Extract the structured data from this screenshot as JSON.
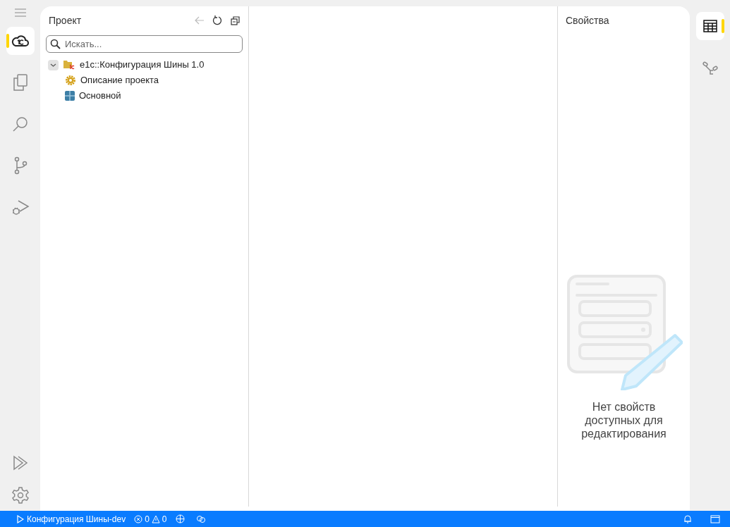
{
  "activity_bar": {
    "items": [
      {
        "kind": "cloud",
        "selected": true
      },
      {
        "kind": "files",
        "selected": false
      },
      {
        "kind": "search",
        "selected": false
      },
      {
        "kind": "branch",
        "selected": false
      },
      {
        "kind": "debug",
        "selected": false
      }
    ],
    "bottom_items": [
      {
        "kind": "run"
      },
      {
        "kind": "settings"
      }
    ]
  },
  "project_panel": {
    "title": "Проект",
    "search": {
      "placeholder": "Искать..."
    },
    "tree": [
      {
        "label": "e1c::Конфигурация Шины 1.0",
        "kind": "project",
        "expanded": true,
        "children": [
          {
            "label": "Описание проекта",
            "kind": "description"
          },
          {
            "label": "Основной",
            "kind": "subsystem"
          }
        ]
      }
    ]
  },
  "properties_panel": {
    "title": "Свойства",
    "empty_message": "Нет свойств доступных для редактирования"
  },
  "right_bar": {
    "items": [
      {
        "kind": "table",
        "selected": true
      },
      {
        "kind": "diagram",
        "selected": false
      }
    ]
  },
  "status_bar": {
    "run_label": "Конфигурация Шины-dev",
    "errors": "0",
    "warnings": "0"
  }
}
